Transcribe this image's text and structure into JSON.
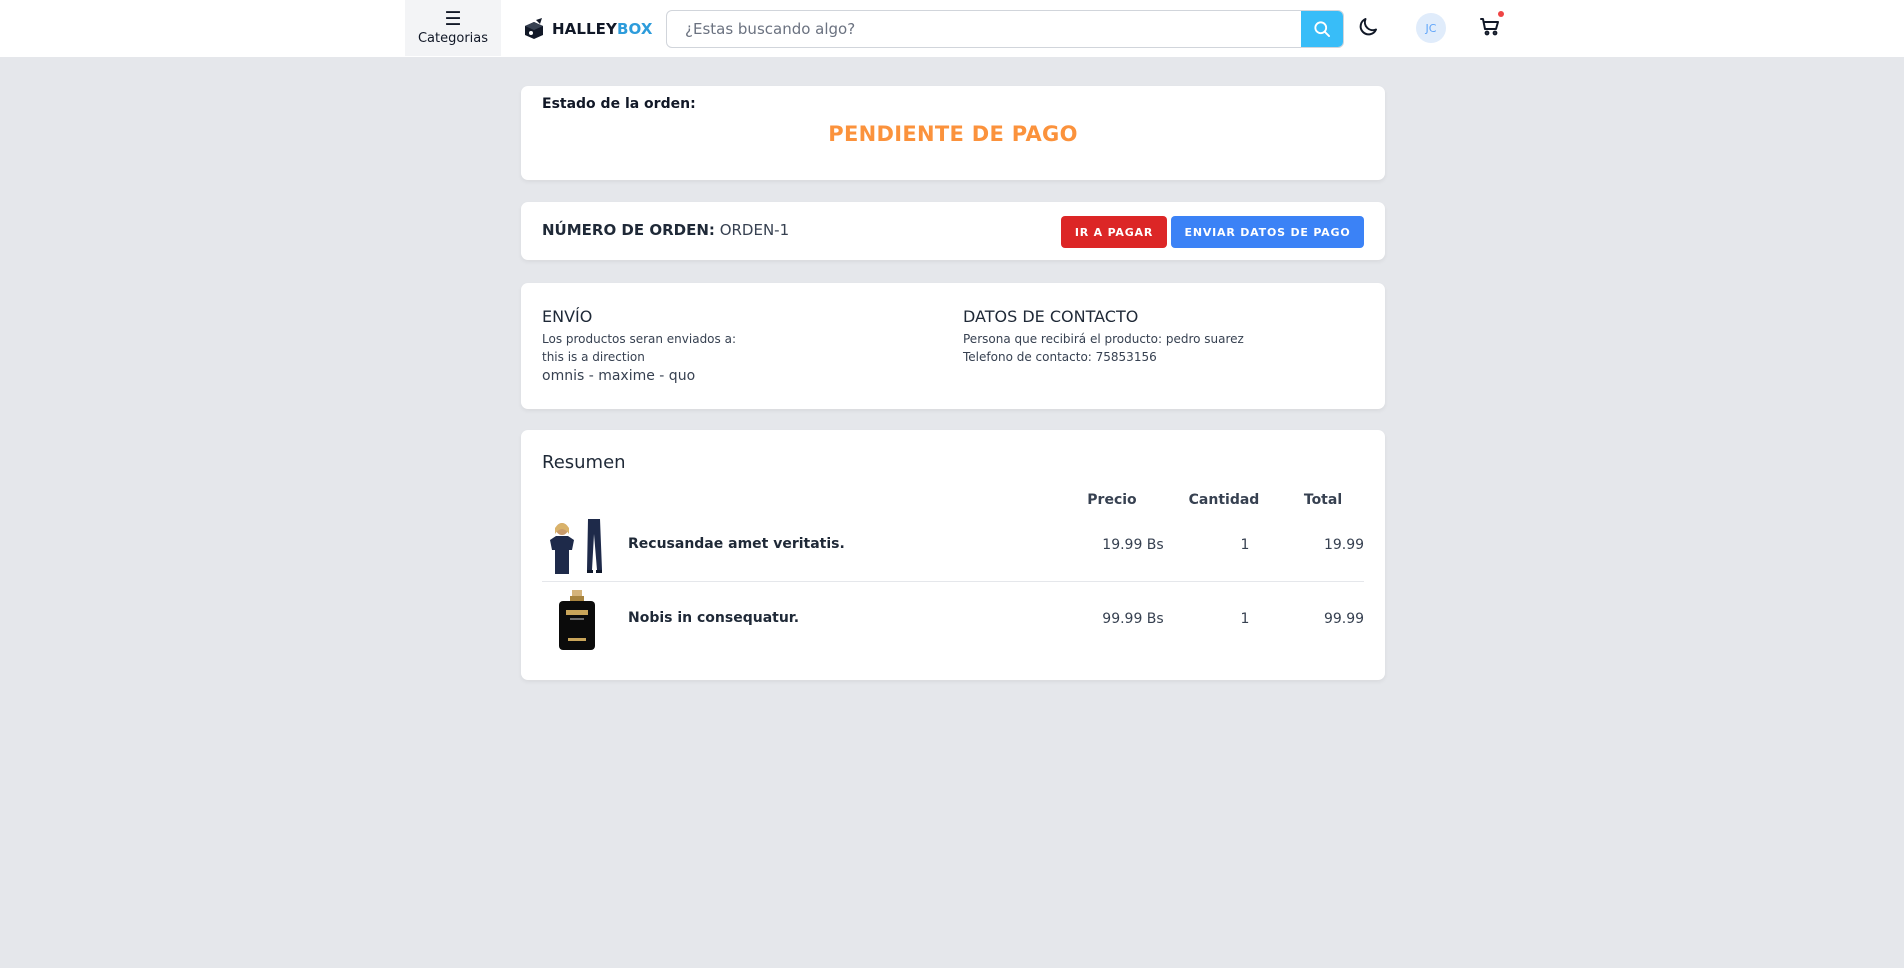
{
  "header": {
    "categories_label": "Categorias",
    "brand_part1": "HALLEY",
    "brand_part2": "BOX",
    "search_placeholder": "¿Estas buscando algo?",
    "avatar_initials": "JC",
    "icons": [
      "menu-icon",
      "logo-box-icon",
      "search-icon",
      "moon-icon",
      "cart-icon"
    ]
  },
  "status": {
    "heading": "Estado de la orden:",
    "value": "PENDIENTE DE PAGO",
    "color": "#fb923c"
  },
  "order": {
    "number_label": "NÚMERO DE ORDEN:",
    "number_value": "ORDEN-1",
    "pay_button": "IR A PAGAR",
    "send_payment_button": "ENVIAR DATOS DE PAGO"
  },
  "shipping": {
    "title": "ENVÍO",
    "line1": "Los productos seran enviados a:",
    "line2": "this is a direction",
    "line3": "omnis - maxime - quo"
  },
  "contact": {
    "title": "DATOS DE CONTACTO",
    "line1": "Persona que recibirá el producto: pedro suarez",
    "line2": "Telefono de contacto: 75853156"
  },
  "summary": {
    "title": "Resumen",
    "columns": {
      "price": "Precio",
      "qty": "Cantidad",
      "total": "Total"
    },
    "items": [
      {
        "name": "Recusandae amet veritatis.",
        "price": "19.99 Bs",
        "qty": "1",
        "total": "19.99",
        "image": "clothing-image"
      },
      {
        "name": "Nobis in consequatur.",
        "price": "99.99 Bs",
        "qty": "1",
        "total": "99.99",
        "image": "perfume-image"
      }
    ]
  },
  "colors": {
    "accent_blue": "#3b82f6",
    "accent_red": "#dc2626",
    "search_button": "#38bdf8",
    "page_bg": "#e5e7eb"
  }
}
